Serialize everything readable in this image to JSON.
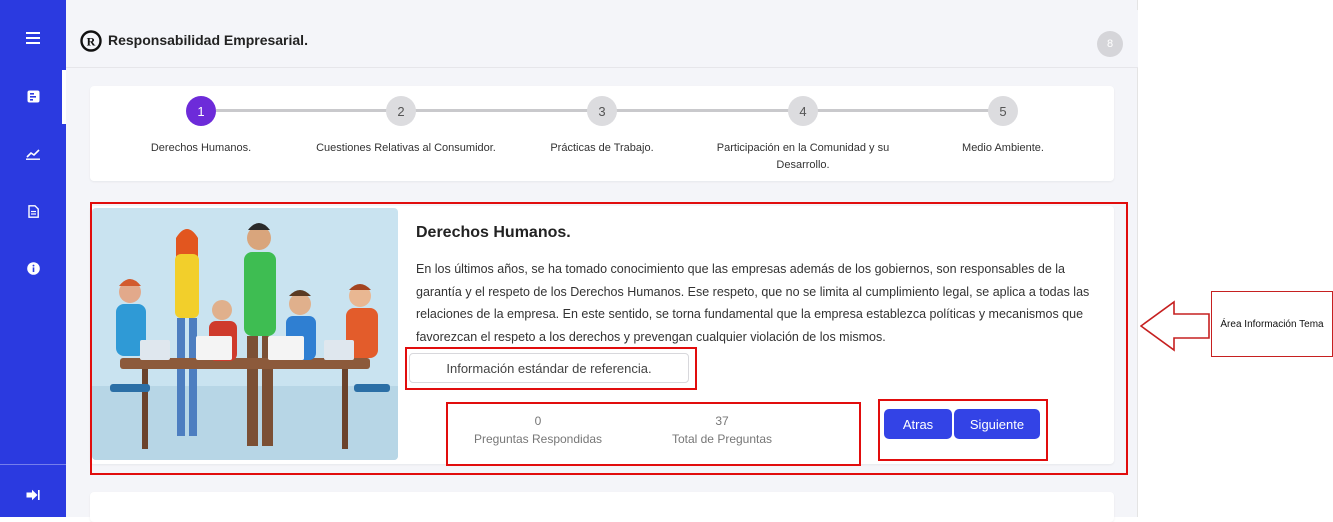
{
  "header": {
    "brand_title": "Responsabilidad Empresarial.",
    "avatar_initial": "8"
  },
  "sidebar": {
    "items": [
      {
        "icon": "menu-icon"
      },
      {
        "icon": "form-icon",
        "active": true
      },
      {
        "icon": "chart-icon"
      },
      {
        "icon": "document-icon"
      },
      {
        "icon": "info-icon"
      }
    ],
    "logout_icon": "logout-icon"
  },
  "stepper": {
    "steps": [
      {
        "number": "1",
        "label": "Derechos Humanos.",
        "active": true
      },
      {
        "number": "2",
        "label": "Cuestiones Relativas al Consumidor."
      },
      {
        "number": "3",
        "label": "Prácticas de Trabajo."
      },
      {
        "number": "4",
        "label": "Participación en la Comunidad y su Desarrollo."
      },
      {
        "number": "5",
        "label": "Medio Ambiente."
      }
    ]
  },
  "topic": {
    "title": "Derechos Humanos.",
    "description": "En los últimos años, se ha tomado conocimiento que las empresas además de los gobiernos, son responsables de la garantía y el respeto de los Derechos Humanos. Ese respeto, que no se limita al cumplimiento legal, se aplica a todas las relaciones de la empresa. En este sentido, se torna fundamental que la empresa establezca políticas y mecanismos que favorezcan el respeto a los derechos y prevengan cualquier violación de los mismos.",
    "reference_button": "Información estándar de referencia.",
    "answered_count": "0",
    "answered_label": "Preguntas Respondidas",
    "total_count": "37",
    "total_label": "Total de Preguntas",
    "back_button": "Atras",
    "next_button": "Siguiente"
  },
  "annotation": {
    "callout": "Área Información Tema"
  },
  "colors": {
    "sidebar": "#2b3ae0",
    "step_active": "#6d2bd9",
    "button": "#3343e6",
    "highlight": "#e10d0d"
  }
}
